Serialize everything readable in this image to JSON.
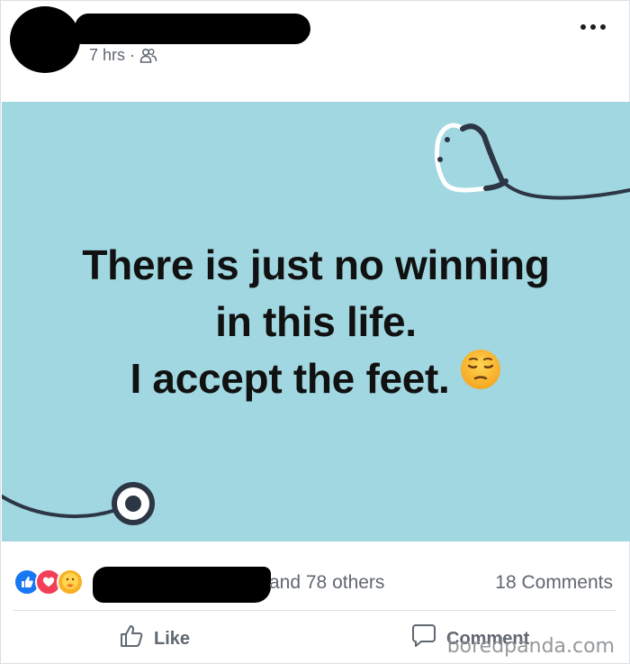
{
  "post": {
    "time": "7 hrs",
    "separator": "·",
    "audience_icon": "friends-icon",
    "more_icon": "more-options-icon"
  },
  "card": {
    "background": "#a0d7e1",
    "lines": [
      "There is just no winning",
      "in this life.",
      "I accept the feet."
    ],
    "emoji": "pensive-face-emoji"
  },
  "reactions": {
    "icons": [
      "like-reaction-icon",
      "love-reaction-icon",
      "care-reaction-icon"
    ],
    "others": "and 78 others",
    "comments": "18 Comments"
  },
  "actions": {
    "like": "Like",
    "comment": "Comment"
  },
  "watermark": "boredpanda.com"
}
